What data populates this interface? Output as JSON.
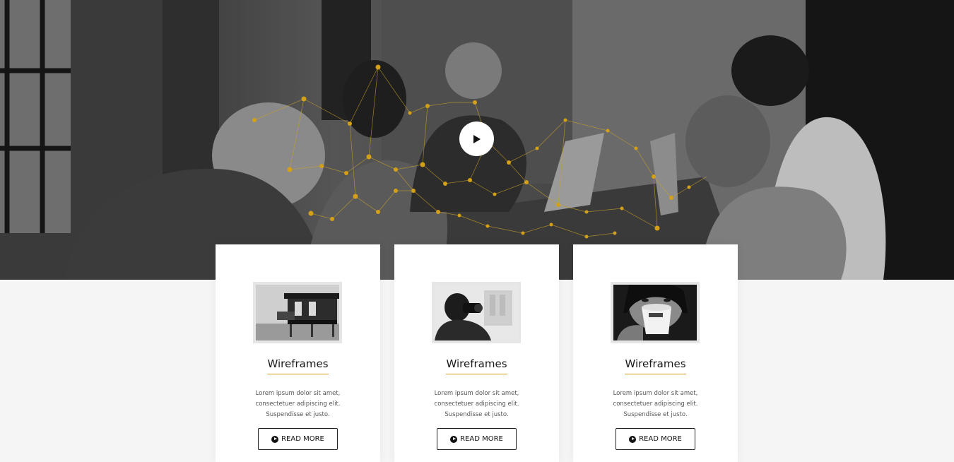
{
  "hero": {
    "play_icon": "play-icon",
    "accent_color": "#d4a017"
  },
  "cards": [
    {
      "title": "Wireframes",
      "description": "Lorem ipsum dolor sit amet, consectetuer adipiscing elit. Suspendisse et justo.",
      "button_label": "READ MORE",
      "button_icon": "play-circle-icon"
    },
    {
      "title": "Wireframes",
      "description": "Lorem ipsum dolor sit amet, consectetuer adipiscing elit. Suspendisse et justo.",
      "button_label": "READ MORE",
      "button_icon": "play-circle-icon"
    },
    {
      "title": "Wireframes",
      "description": "Lorem ipsum dolor sit amet, consectetuer adipiscing elit. Suspendisse et justo.",
      "button_label": "READ MORE",
      "button_icon": "play-circle-icon"
    }
  ]
}
